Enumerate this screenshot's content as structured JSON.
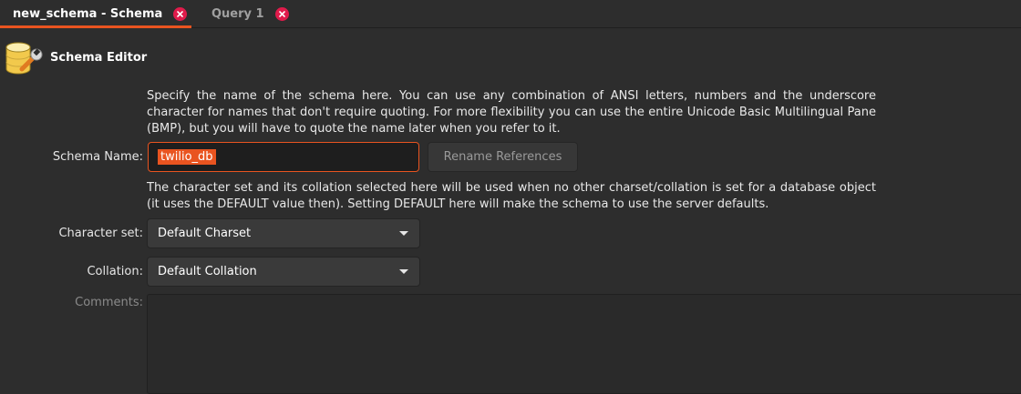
{
  "tabs": [
    {
      "label": "new_schema - Schema",
      "active": true
    },
    {
      "label": "Query 1",
      "active": false
    }
  ],
  "header": {
    "title": "Schema Editor",
    "icon": "database-schema-icon"
  },
  "name_description": "Specify the name of the schema here. You can use any combination of ANSI letters, numbers and the underscore character for names that don't require quoting. For more flexibility you can use the entire Unicode Basic Multilingual Pane (BMP), but you will have to quote the name later when you refer to it.",
  "schema_name": {
    "label": "Schema Name:",
    "value": "twilio_db"
  },
  "rename_button": {
    "label": "Rename References"
  },
  "charset_description": "The character set and its collation selected here will be used when no other charset/collation is set for a database object (it uses the DEFAULT value then). Setting DEFAULT here will make the schema to use the server defaults.",
  "character_set": {
    "label": "Character set:",
    "value": "Default Charset"
  },
  "collation": {
    "label": "Collation:",
    "value": "Default Collation"
  },
  "comments": {
    "label": "Comments:",
    "value": ""
  },
  "colors": {
    "accent": "#e95420",
    "close": "#e01b4b",
    "background": "#2d2d2d"
  }
}
